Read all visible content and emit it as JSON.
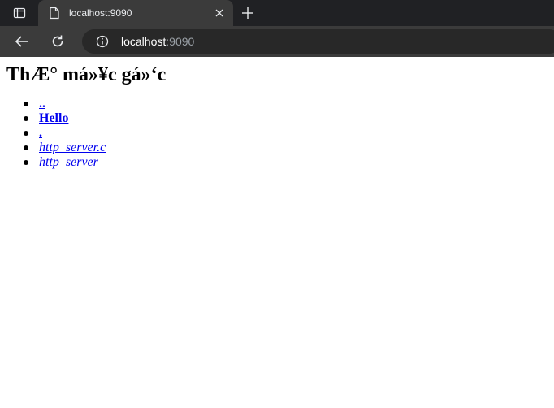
{
  "browser": {
    "tab_title": "localhost:9090",
    "address": {
      "host": "localhost",
      "port": ":9090"
    },
    "icons": {
      "tab_actions": "tab-actions-icon",
      "favicon": "file-icon",
      "close": "close-icon",
      "new_tab": "plus-icon",
      "back": "back-arrow-icon",
      "reload": "reload-icon",
      "site_info": "info-icon"
    }
  },
  "page": {
    "heading": "ThÆ° má»¥c gá»‘c",
    "entries": [
      {
        "label": "..",
        "kind": "dir"
      },
      {
        "label": "Hello",
        "kind": "dir"
      },
      {
        "label": ".",
        "kind": "dir"
      },
      {
        "label": "http_server.c",
        "kind": "file"
      },
      {
        "label": "http_server",
        "kind": "file"
      }
    ]
  }
}
